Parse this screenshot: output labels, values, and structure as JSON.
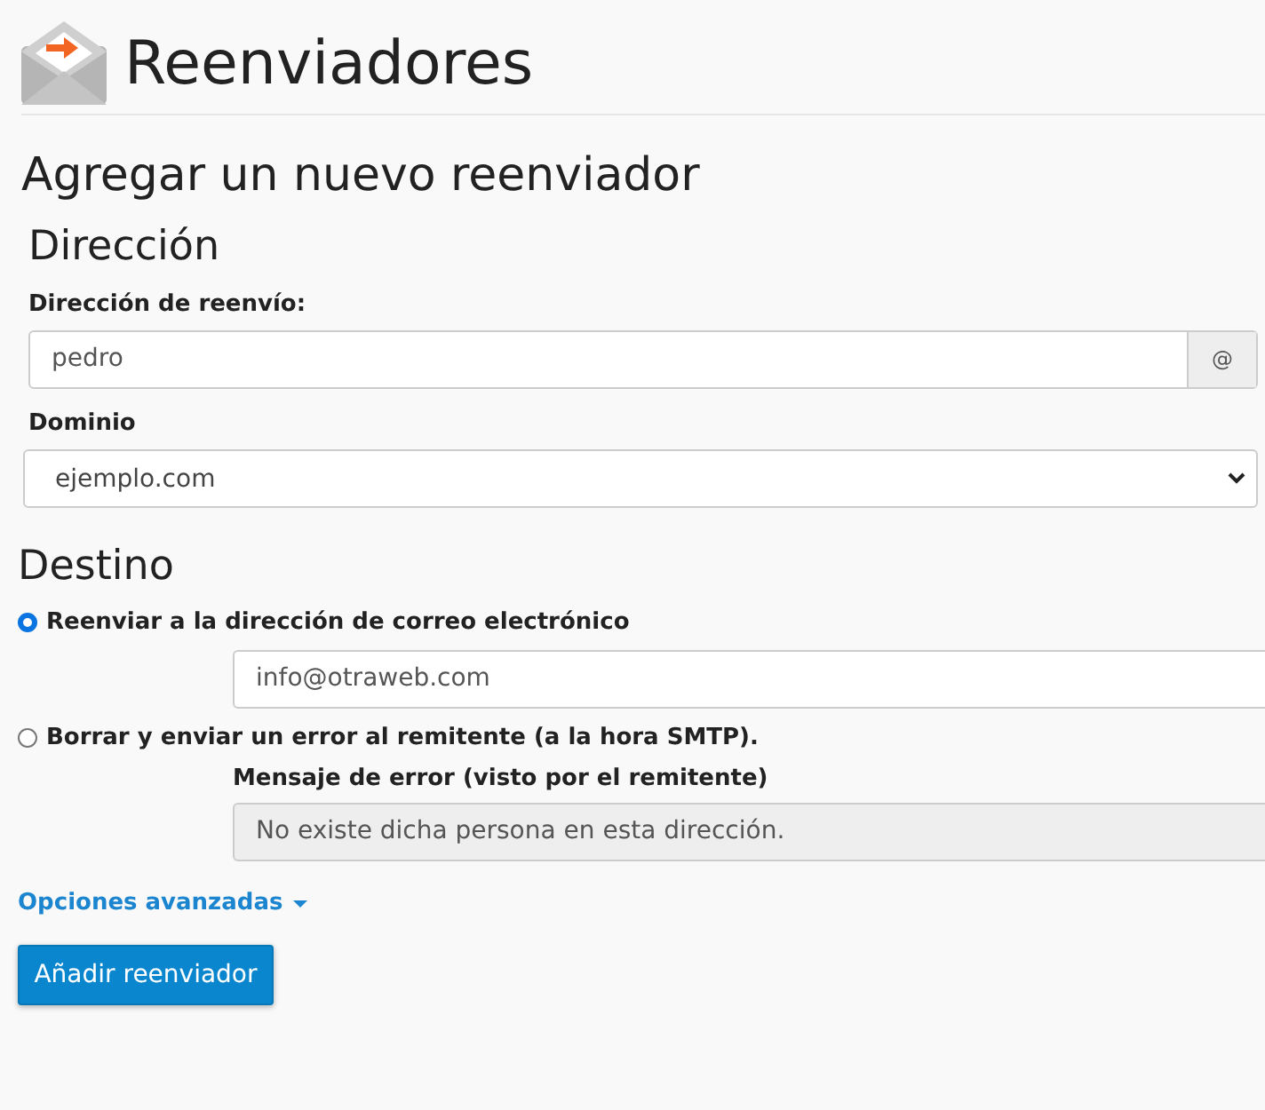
{
  "page_title": "Reenviadores",
  "form_title": "Agregar un nuevo reenviador",
  "address_section": {
    "heading": "Dirección",
    "address_label": "Dirección de reenvío:",
    "address_value": "pedro",
    "address_addon": "@",
    "domain_label": "Dominio",
    "domain_value": "ejemplo.com"
  },
  "destination_section": {
    "heading": "Destino",
    "options": [
      {
        "label": "Reenviar a la dirección de correo electrónico",
        "selected": true,
        "field_value": "info@otraweb.com",
        "disabled": false
      },
      {
        "label": "Borrar y enviar un error al remitente (a la hora SMTP).",
        "selected": false,
        "field_label": "Mensaje de error (visto por el remitente)",
        "field_value": "No existe dicha persona en esta dirección.",
        "disabled": true
      }
    ]
  },
  "advanced_link": "Opciones avanzadas",
  "submit_button": "Añadir reenviador"
}
